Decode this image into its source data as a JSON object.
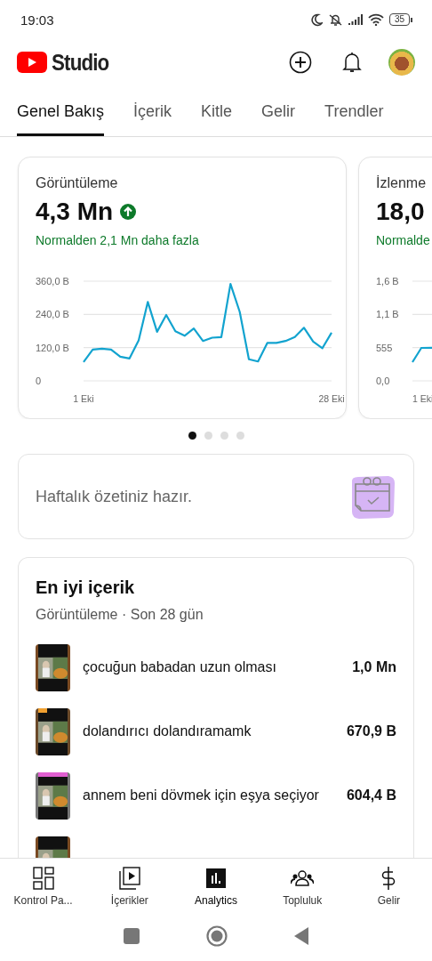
{
  "status_bar": {
    "time": "19:03",
    "battery": "35"
  },
  "header": {
    "logo_text": "Studio"
  },
  "tabs": [
    {
      "label": "Genel Bakış",
      "selected": true
    },
    {
      "label": "İçerik",
      "selected": false
    },
    {
      "label": "Kitle",
      "selected": false
    },
    {
      "label": "Gelir",
      "selected": false
    },
    {
      "label": "Trendler",
      "selected": false
    }
  ],
  "metric_cards": [
    {
      "title": "Görüntüleme",
      "value": "4,3 Mn",
      "rising": true,
      "comparison": "Normalden 2,1 Mn daha fazla",
      "chart_data": {
        "type": "line",
        "x": [
          1,
          2,
          3,
          4,
          5,
          6,
          7,
          8,
          9,
          10,
          11,
          12,
          13,
          14,
          15,
          16,
          17,
          18,
          19,
          20,
          21,
          22,
          23,
          24,
          25,
          26,
          27,
          28
        ],
        "xlim": [
          1,
          28
        ],
        "xticks": [
          {
            "value": 1,
            "label": "1 Eki"
          },
          {
            "value": 28,
            "label": "28 Eki"
          }
        ],
        "ylim": [
          0,
          360
        ],
        "yticks": [
          {
            "value": 360,
            "label": "360,0 B"
          },
          {
            "value": 240,
            "label": "240,0 B"
          },
          {
            "value": 120,
            "label": "120,0 B"
          },
          {
            "value": 0,
            "label": "0"
          }
        ],
        "series": [
          {
            "color": "#12a3cf",
            "values": [
              68,
              113,
              116,
              113,
              87,
              81,
              146,
              285,
              177,
              238,
              179,
              163,
              189,
              144,
              156,
              158,
              350,
              249,
              78,
              70,
              137,
              137,
              144,
              158,
              192,
              142,
              118,
              174
            ]
          }
        ]
      }
    },
    {
      "title": "İzlenme",
      "value": "18,0",
      "comparison": "Normalde",
      "y_labels": [
        "1,6 B",
        "1,1 B",
        "555",
        "0,0"
      ],
      "x_label": "1 Eki"
    }
  ],
  "pager": [
    {
      "selected": true
    },
    {
      "selected": false
    },
    {
      "selected": false
    },
    {
      "selected": false
    }
  ],
  "summary_card": {
    "text": "Haftalık özetiniz hazır."
  },
  "top_content": {
    "title": "En iyi içerik",
    "subtitle": "Görüntüleme · Son 28 gün",
    "videos": [
      {
        "kind": "video",
        "title": "çocuğun babadan uzun olması",
        "views": "1,0 Mn"
      },
      {
        "kind": "video",
        "title": "dolandırıcı dolandıramamk",
        "views": "670,9 B"
      },
      {
        "kind": "video",
        "title": "annem beni dövmek için eşya seçiyor",
        "views": "604,4 B"
      },
      {
        "kind": "picture"
      }
    ]
  },
  "bottom_nav": [
    {
      "label": "Kontrol Pa...",
      "selected": false
    },
    {
      "label": "İçerikler",
      "selected": false
    },
    {
      "label": "Analytics",
      "selected": true
    },
    {
      "label": "Topluluk",
      "selected": false
    },
    {
      "label": "Gelir",
      "selected": false
    }
  ]
}
